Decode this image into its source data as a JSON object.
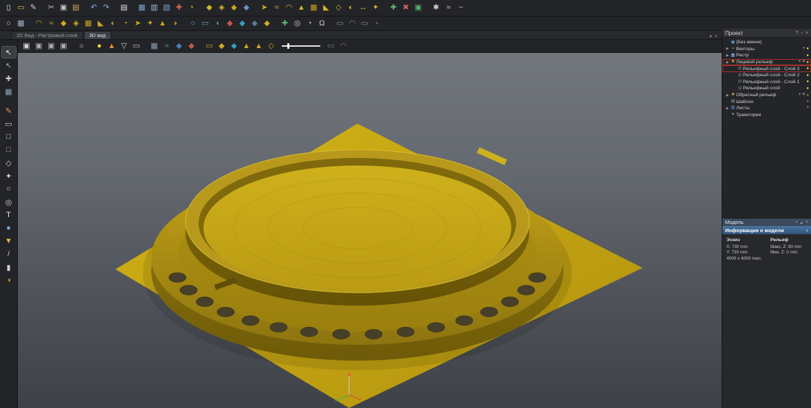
{
  "icons": {
    "plus": "+",
    "menu": "≡",
    "bulb": "●"
  },
  "colors": {
    "accent_gold": "#d0aa20",
    "selection_red": "#a83028",
    "bulb_yellow": "#ffd84a",
    "model_gold": "#c9a713",
    "header_blue": "#3a6ea5"
  },
  "tabs": [
    {
      "cls": "tab",
      "label": "2D Вид - Растровый слой"
    },
    {
      "cls": "tab active",
      "label": "3D вид"
    }
  ],
  "tab_controls": {
    "menu": "▾",
    "close": "×"
  },
  "toolbars": {
    "slider": {
      "value_pct": 14
    },
    "row1": [
      {
        "cls": "tbi",
        "name": "new-file-icon",
        "glyph": "▯",
        "color": "#e8e8e8"
      },
      {
        "cls": "tbi",
        "name": "open-file-icon",
        "glyph": "▭",
        "color": "#e2bc4e"
      },
      {
        "cls": "tbi",
        "name": "save-file-icon",
        "glyph": "✎",
        "color": "#d8d8d8"
      },
      {
        "cls": "tbi gap",
        "name": "cut-icon",
        "glyph": "✂",
        "color": "#c6c6c6"
      },
      {
        "cls": "tbi",
        "name": "copy-icon",
        "glyph": "▣",
        "color": "#c6c6c6"
      },
      {
        "cls": "tbi",
        "name": "paste-icon",
        "glyph": "▤",
        "color": "#cdab58"
      },
      {
        "cls": "tbi gap",
        "name": "undo-icon",
        "glyph": "↶",
        "color": "#8fb3e0"
      },
      {
        "cls": "tbi",
        "name": "redo-icon",
        "glyph": "↷",
        "color": "#8fb3e0"
      },
      {
        "cls": "tbi gap",
        "name": "notes-icon",
        "glyph": "▤",
        "color": "#e0e0e0"
      },
      {
        "cls": "tbi gap",
        "name": "grid-view-icon",
        "glyph": "▦",
        "color": "#7ba3d6"
      },
      {
        "cls": "tbi",
        "name": "table-view-icon",
        "glyph": "▥",
        "color": "#a9bfd9"
      },
      {
        "cls": "tbi",
        "name": "layout-view-icon",
        "glyph": "▧",
        "color": "#7ba3d6"
      },
      {
        "cls": "tbi",
        "name": "measure-tool-icon",
        "glyph": "✚",
        "color": "#cf6a4c"
      },
      {
        "cls": "tbi",
        "name": "protractor-icon",
        "glyph": "◔",
        "color": "#e4c44e"
      },
      {
        "cls": "tbi gap",
        "name": "relief-new-icon",
        "glyph": "◆",
        "color": "#d8b62a"
      },
      {
        "cls": "tbi",
        "name": "relief-load-icon",
        "glyph": "◈",
        "color": "#d8b62a"
      },
      {
        "cls": "tbi",
        "name": "relief-save-icon",
        "glyph": "◆",
        "color": "#c8a41e"
      },
      {
        "cls": "tbi",
        "name": "relief-blue-icon",
        "glyph": "◆",
        "color": "#6a92c8"
      },
      {
        "cls": "tbi gap",
        "name": "relief-paste-icon",
        "glyph": "➤",
        "color": "#d8b62a"
      },
      {
        "cls": "tbi",
        "name": "relief-wave-icon",
        "glyph": "≈",
        "color": "#d8b62a"
      },
      {
        "cls": "tbi",
        "name": "relief-smooth-icon",
        "glyph": "◠",
        "color": "#d8b62a"
      },
      {
        "cls": "tbi",
        "name": "relief-sculpt-icon",
        "glyph": "▲",
        "color": "#d8b62a"
      },
      {
        "cls": "tbi",
        "name": "relief-texture-icon",
        "glyph": "▦",
        "color": "#caa51e"
      },
      {
        "cls": "tbi",
        "name": "relief-emboss-icon",
        "glyph": "◣",
        "color": "#d8b62a"
      },
      {
        "cls": "tbi",
        "name": "relief-offset-icon",
        "glyph": "◇",
        "color": "#d8b62a"
      },
      {
        "cls": "tbi",
        "name": "relief-mirror-icon",
        "glyph": "◐",
        "color": "#d8b62a"
      },
      {
        "cls": "tbi",
        "name": "relief-scale-icon",
        "glyph": "↔",
        "color": "#d8b62a"
      },
      {
        "cls": "tbi",
        "name": "relief-combine-icon",
        "glyph": "✦",
        "color": "#d8b62a"
      },
      {
        "cls": "tbi gap",
        "name": "relief-add-icon",
        "glyph": "✚",
        "color": "#5cb86a"
      },
      {
        "cls": "tbi",
        "name": "relief-subtract-icon",
        "glyph": "✖",
        "color": "#c86a5a"
      },
      {
        "cls": "tbi",
        "name": "green-grid-icon",
        "glyph": "▣",
        "color": "#5cb86a"
      },
      {
        "cls": "tbi gap",
        "name": "dots-tool-icon",
        "glyph": "✱",
        "color": "#d0d0d0"
      },
      {
        "cls": "tbi",
        "name": "spline-tool-icon",
        "glyph": "≈",
        "color": "#d0d0d0"
      },
      {
        "cls": "tbi",
        "name": "wave-tool-icon",
        "glyph": "~",
        "color": "#d0d0d0"
      }
    ],
    "row2": [
      {
        "cls": "tbi",
        "name": "zoom-tool-icon",
        "glyph": "○",
        "color": "#d8d8d8"
      },
      {
        "cls": "tbi",
        "name": "preferences-icon",
        "glyph": "▦",
        "color": "#9fb3c8"
      },
      {
        "cls": "tbi gap",
        "name": "relief-smooth2-icon",
        "glyph": "◠",
        "color": "#d0aa20"
      },
      {
        "cls": "tbi",
        "name": "relief-wave2-icon",
        "glyph": "≈",
        "color": "#d0aa20"
      },
      {
        "cls": "tbi",
        "name": "relief-diamond-icon",
        "glyph": "◆",
        "color": "#d0aa20"
      },
      {
        "cls": "tbi",
        "name": "relief-facet-icon",
        "glyph": "◈",
        "color": "#d0aa20"
      },
      {
        "cls": "tbi",
        "name": "relief-grid-icon",
        "glyph": "▦",
        "color": "#c8a41e"
      },
      {
        "cls": "tbi",
        "name": "relief-slope-icon",
        "glyph": "◣",
        "color": "#d0aa20"
      },
      {
        "cls": "tbi",
        "name": "relief-dome-icon",
        "glyph": "◐",
        "color": "#d0aa20"
      },
      {
        "cls": "tbi",
        "name": "relief-angle-icon",
        "glyph": "◔",
        "color": "#d0aa20"
      },
      {
        "cls": "tbi",
        "name": "relief-arrow-icon",
        "glyph": "➤",
        "color": "#d0aa20"
      },
      {
        "cls": "tbi",
        "name": "relief-star-icon",
        "glyph": "✦",
        "color": "#d0aa20"
      },
      {
        "cls": "tbi",
        "name": "relief-tri-icon",
        "glyph": "▲",
        "color": "#d0aa20"
      },
      {
        "cls": "tbi",
        "name": "relief-half-icon",
        "glyph": "◑",
        "color": "#d0aa20"
      },
      {
        "cls": "tbi gap",
        "name": "vector-ellipse-icon",
        "glyph": "○",
        "color": "#5aa8c8"
      },
      {
        "cls": "tbi",
        "name": "vector-rect-icon",
        "glyph": "▭",
        "color": "#5aa8c8"
      },
      {
        "cls": "tbi",
        "name": "vector-fish-icon",
        "glyph": "◖",
        "color": "#4aa0c0"
      },
      {
        "cls": "tbi",
        "name": "red-diamond-tool-icon",
        "glyph": "◆",
        "color": "#c85a4a"
      },
      {
        "cls": "tbi",
        "name": "teal-diamond-tool-icon",
        "glyph": "◆",
        "color": "#3a9ec0"
      },
      {
        "cls": "tbi",
        "name": "navy-diamond-tool-icon",
        "glyph": "◆",
        "color": "#5a7a9c"
      },
      {
        "cls": "tbi",
        "name": "gold-diamond-tool-icon",
        "glyph": "◆",
        "color": "#d0aa20"
      },
      {
        "cls": "tbi gap",
        "name": "add-layer-icon",
        "glyph": "✚",
        "color": "#5cb86a"
      },
      {
        "cls": "tbi",
        "name": "target-tool-icon",
        "glyph": "◎",
        "color": "#cfcfcf"
      },
      {
        "cls": "tbi",
        "name": "spiral-tool-icon",
        "glyph": "◔",
        "color": "#cfcfcf"
      },
      {
        "cls": "tbi",
        "name": "omega-tool-icon",
        "glyph": "Ω",
        "color": "#cfcfcf"
      },
      {
        "cls": "tbi gap",
        "name": "rect-faint-icon",
        "glyph": "▭",
        "color": "#8a8a8a"
      },
      {
        "cls": "tbi",
        "name": "corner-faint-icon",
        "glyph": "◠",
        "color": "#8a8a8a"
      },
      {
        "cls": "tbi",
        "name": "dash-faint-icon",
        "glyph": "▭",
        "color": "#8a8a8a"
      },
      {
        "cls": "tbi",
        "name": "dot-faint-icon",
        "glyph": "▫",
        "color": "#8a8a8a"
      }
    ],
    "row3": [
      {
        "cls": "tbi",
        "name": "view-iso-icon",
        "glyph": "▣",
        "color": "#d8d8d8"
      },
      {
        "cls": "tbi",
        "name": "view-front-icon",
        "glyph": "▣",
        "color": "#b0b0b0"
      },
      {
        "cls": "tbi",
        "name": "view-side-icon",
        "glyph": "▣",
        "color": "#b0b0b0"
      },
      {
        "cls": "tbi",
        "name": "view-top-icon",
        "glyph": "▣",
        "color": "#b0b0b0"
      },
      {
        "cls": "tbi gap",
        "name": "zoom-window-icon",
        "glyph": "○",
        "color": "#d8d8d8"
      },
      {
        "cls": "tbi gap",
        "name": "light-icon",
        "glyph": "●",
        "color": "#ffd84a"
      },
      {
        "cls": "tbi",
        "name": "material-icon",
        "glyph": "▲",
        "color": "#e09040"
      },
      {
        "cls": "tbi",
        "name": "plane-toggle-icon",
        "glyph": "▽",
        "color": "#d0d0d0"
      },
      {
        "cls": "tbi",
        "name": "section-icon",
        "glyph": "▭",
        "color": "#d0d0d0"
      },
      {
        "cls": "tbi gap",
        "name": "grid-toggle-icon",
        "glyph": "▦",
        "color": "#8fa3b8"
      },
      {
        "cls": "tbi",
        "name": "vectors-toggle-icon",
        "glyph": "≈",
        "color": "#4aa0c0"
      },
      {
        "cls": "tbi",
        "name": "blue-diamond-icon",
        "glyph": "◆",
        "color": "#4a7ec0"
      },
      {
        "cls": "tbi",
        "name": "red-diamond-icon",
        "glyph": "◆",
        "color": "#c85a4a"
      },
      {
        "cls": "tbi gap",
        "name": "gold-flat-icon",
        "glyph": "▭",
        "color": "#d0aa20"
      },
      {
        "cls": "tbi",
        "name": "gold-diamond-icon",
        "glyph": "◆",
        "color": "#d0aa20"
      },
      {
        "cls": "tbi",
        "name": "teal-diamond-icon",
        "glyph": "◆",
        "color": "#3a9ec0"
      },
      {
        "cls": "tbi",
        "name": "gold-tri-icon",
        "glyph": "▲",
        "color": "#d0aa20"
      },
      {
        "cls": "tbi",
        "name": "cone-icon",
        "glyph": "▲",
        "color": "#e0a030"
      },
      {
        "cls": "tbi",
        "name": "draft-icon",
        "glyph": "◇",
        "color": "#d0aa20"
      }
    ],
    "row3_after": [
      {
        "cls": "tbi",
        "name": "faint-rect-icon",
        "glyph": "▭",
        "color": "#7d7d7d"
      },
      {
        "cls": "tbi",
        "name": "faint-corner-icon",
        "glyph": "◠",
        "color": "#7d7d7d"
      }
    ],
    "left": [
      {
        "cls": "tbiv active",
        "name": "select-tool-icon",
        "glyph": "↖",
        "color": "#f0f0f0"
      },
      {
        "cls": "tbiv",
        "name": "node-edit-icon",
        "glyph": "↖",
        "color": "#9ab0c8"
      },
      {
        "cls": "tbiv",
        "name": "transform-icon",
        "glyph": "✚",
        "color": "#c8c8c8"
      },
      {
        "cls": "tbiv",
        "name": "grid-snap-icon",
        "glyph": "▦",
        "color": "#8fa3b8"
      },
      {
        "cls": "tbiv gap",
        "name": "sculpt-icon",
        "glyph": "✎",
        "color": "#e0a050"
      },
      {
        "cls": "tbiv",
        "name": "erase-icon",
        "glyph": "▭",
        "color": "#d8d8d8"
      },
      {
        "cls": "tbiv",
        "name": "rect-tool-icon",
        "glyph": "□",
        "color": "#d8d8d8"
      },
      {
        "cls": "tbiv",
        "name": "rounded-rect-tool-icon",
        "glyph": "□",
        "color": "#b8b8b8"
      },
      {
        "cls": "tbiv",
        "name": "polygon-tool-icon",
        "glyph": "◇",
        "color": "#d8d8d8"
      },
      {
        "cls": "tbiv",
        "name": "star-tool-icon",
        "glyph": "✦",
        "color": "#d8d8d8"
      },
      {
        "cls": "tbiv",
        "name": "ellipse-tool-icon",
        "glyph": "○",
        "color": "#d8d8d8"
      },
      {
        "cls": "tbiv",
        "name": "circle-tool-icon",
        "glyph": "◎",
        "color": "#d8d8d8"
      },
      {
        "cls": "tbiv",
        "name": "text-tool-icon",
        "glyph": "T",
        "color": "#f0f0f0"
      },
      {
        "cls": "tbiv",
        "name": "droplet-tool-icon",
        "glyph": "●",
        "color": "#7ab0d8"
      },
      {
        "cls": "tbiv",
        "name": "pin-tool-icon",
        "glyph": "▼",
        "color": "#e0c04a"
      },
      {
        "cls": "tbiv",
        "name": "knife-tool-icon",
        "glyph": "/",
        "color": "#d0d0d0"
      },
      {
        "cls": "tbiv",
        "name": "brush-tool-icon",
        "glyph": "▮",
        "color": "#d0d0d0"
      },
      {
        "cls": "tbiv",
        "name": "fill-tool-icon",
        "glyph": "◑",
        "color": "#e0a040"
      }
    ]
  },
  "right_panel": {
    "project": {
      "title": "Проект",
      "controls": {
        "help": "?",
        "float": "▫",
        "close": "×"
      },
      "tree": [
        {
          "row_class": "trow lvl0",
          "expander": "",
          "icon_glyph": "▣",
          "icon_color": "#5a9ad8",
          "icon_name": "project-root-icon",
          "label": "(Без имени)"
        },
        {
          "row_class": "trow lvl0 t-plus t-bulb",
          "expander": "▶",
          "icon_glyph": "≈",
          "icon_color": "#8fb3e0",
          "icon_name": "vectors-icon",
          "label": "Векторы"
        },
        {
          "row_class": "trow lvl0 t-bulb",
          "expander": "▶",
          "icon_glyph": "▦",
          "icon_color": "#8fb3e0",
          "icon_name": "raster-icon",
          "label": "Растр"
        },
        {
          "row_class": "trow lvl0 sel t-plus t-menu t-bulb",
          "expander": "▶",
          "icon_glyph": "★",
          "icon_color": "#e8c03a",
          "icon_name": "face-relief-icon",
          "label": "Лицевой рельеф"
        },
        {
          "row_class": "trow lvl1 sel t-bulb",
          "expander": "",
          "icon_glyph": "⊙",
          "icon_color": "#9ab0c8",
          "icon_name": "relief-layer-icon",
          "label": "Рельефный слой - Слой 3"
        },
        {
          "row_class": "trow lvl1 t-bulb",
          "expander": "",
          "icon_glyph": "⊙",
          "icon_color": "#9ab0c8",
          "icon_name": "relief-layer-icon",
          "label": "Рельефный слой - Слой 2"
        },
        {
          "row_class": "trow lvl1 t-bulb",
          "expander": "",
          "icon_glyph": "⊙",
          "icon_color": "#9ab0c8",
          "icon_name": "relief-layer-icon",
          "label": "Рельефный слой - Слой 1"
        },
        {
          "row_class": "trow lvl1 t-bulb",
          "expander": "",
          "icon_glyph": "⊙",
          "icon_color": "#9ab0c8",
          "icon_name": "relief-layer-icon",
          "label": "Рельефный слой"
        },
        {
          "row_class": "trow lvl0 t-plus t-menu t-bulb t-dim",
          "expander": "▶",
          "icon_glyph": "★",
          "icon_color": "#e8c03a",
          "icon_name": "back-relief-icon",
          "label": "Обратный рельеф"
        },
        {
          "row_class": "trow lvl0 t-bulb t-dim",
          "expander": "",
          "icon_glyph": "▤",
          "icon_color": "#9a9a9a",
          "icon_name": "template-icon",
          "label": "Шаблон"
        },
        {
          "row_class": "trow lvl0 t-plus",
          "expander": "▶",
          "icon_glyph": "▥",
          "icon_color": "#5a9ad8",
          "icon_name": "sheets-icon",
          "label": "Листы"
        },
        {
          "row_class": "trow lvl0",
          "expander": "",
          "icon_glyph": "✦",
          "icon_color": "#9a9a9a",
          "icon_name": "toolpaths-icon",
          "label": "Траектории"
        }
      ]
    },
    "model_bar": {
      "title": "Модель",
      "controls": {
        "pin": "▪",
        "collapse": "▴",
        "close": "×"
      }
    },
    "info": {
      "title": "Информация о модели",
      "collapse": "▴",
      "sketch_header": "Эскиз",
      "relief_header": "Рельеф",
      "sketch_x": "X: 730 mm",
      "sketch_y": "Y: 730 mm",
      "pixels": "4000 x 4000 пикс.",
      "relief_max": "Макс. Z: 80 mm",
      "relief_min": "Мин. Z: 0 mm"
    }
  }
}
